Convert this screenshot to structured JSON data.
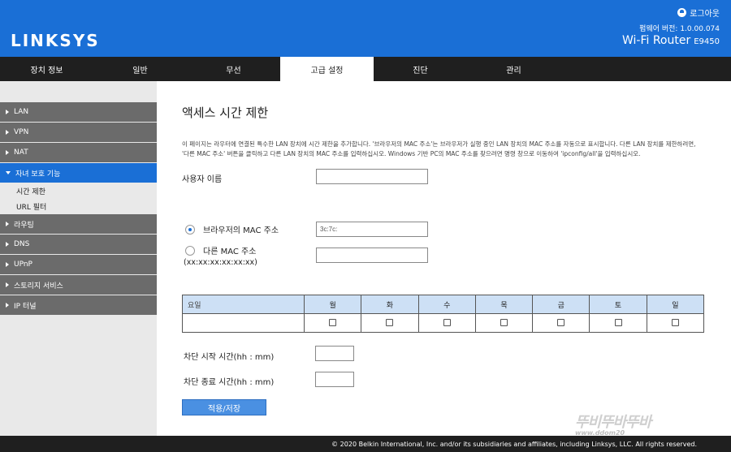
{
  "header": {
    "logo": "LINKSYS",
    "logout": "로그아웃",
    "firmware": "펌웨어 버전: 1.0.00.074",
    "model_name": "Wi-Fi Router",
    "model_number": "E9450"
  },
  "nav": {
    "tabs": [
      "장치 정보",
      "일반",
      "무선",
      "고급 설정",
      "진단",
      "관리"
    ],
    "active": "고급 설정"
  },
  "sidebar": {
    "items": [
      {
        "label": "LAN"
      },
      {
        "label": "VPN"
      },
      {
        "label": "NAT"
      },
      {
        "label": "자녀 보호 기능",
        "open": true,
        "subitems": [
          "시간 제한",
          "URL 필터"
        ]
      },
      {
        "label": "라우팅"
      },
      {
        "label": "DNS"
      },
      {
        "label": "UPnP"
      },
      {
        "label": "스토리지 서비스"
      },
      {
        "label": "IP 터널"
      }
    ]
  },
  "main": {
    "title": "액세스 시간 제한",
    "description": "이 페이지는 라우터에 연결된 특수한 LAN 장치에 시간 제한을 추가합니다. '브라우저의 MAC 주소'는 브라우저가 실행 중인 LAN 장치의 MAC 주소를 자동으로 표시합니다. 다른 LAN 장치를 제한하려면, '다른 MAC 주소' 버튼을 클릭하고 다른 LAN 장치의 MAC 주소를 입력하십시오. Windows 기반 PC의 MAC 주소를 찾으려면 명령 창으로 이동하여 'ipconfig/all'을 입력하십시오.",
    "username_label": "사용자 이름",
    "username_value": "",
    "browser_mac_label": "브라우저의 MAC 주소",
    "browser_mac_value": "3c:7c:",
    "other_mac_label": "다른 MAC 주소",
    "other_mac_format": "(xx:xx:xx:xx:xx:xx)",
    "other_mac_value": "",
    "selected_option": "browser",
    "table": {
      "first_header": "요일",
      "days": [
        "월",
        "화",
        "수",
        "목",
        "금",
        "토",
        "일"
      ]
    },
    "start_time_label": "차단 시작 시간(hh : mm)",
    "end_time_label": "차단 종료 시간(hh : mm)",
    "save_button": "적용/저장"
  },
  "footer": {
    "copyright": "© 2020 Belkin International, Inc. and/or its subsidiaries and affiliates, including Linksys, LLC. All rights reserved."
  },
  "watermark": {
    "text": "뚜비뚜바뚜바",
    "url": "www.ddom20"
  },
  "colors": {
    "brand_blue": "#1a6fd6",
    "nav_bg": "#1f1f1f",
    "sidebar_item": "#6b6b6b",
    "table_header": "#cde0f5"
  }
}
